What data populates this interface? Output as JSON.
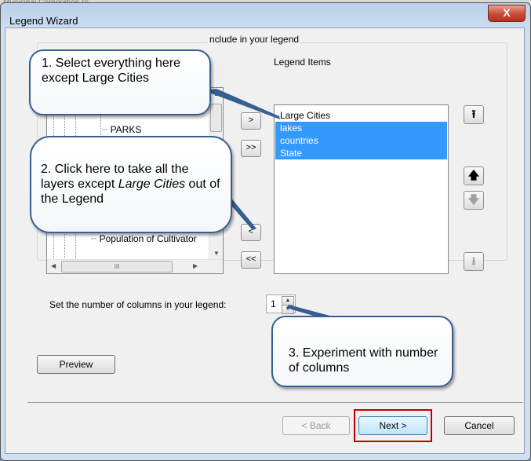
{
  "background": {
    "map_text": "Municipal Corporation ro"
  },
  "window": {
    "title": "Legend Wizard",
    "close_glyph": "X"
  },
  "group": {
    "title": "nclude in your legend"
  },
  "layers_tree": {
    "items": [
      "PARKS",
      "Population of Cultivator"
    ],
    "hscroll_thumb_glyph": "III"
  },
  "transfer_buttons": {
    "add": ">",
    "add_all": ">>",
    "remove": "<",
    "remove_all": "<<"
  },
  "legend_items": {
    "label": "Legend Items",
    "items": [
      {
        "text": "Large Cities",
        "selected": false
      },
      {
        "text": "lakes",
        "selected": true
      },
      {
        "text": "countries",
        "selected": true
      },
      {
        "text": "State",
        "selected": true
      }
    ]
  },
  "order_buttons": {
    "top": "⭱",
    "up": "🡅",
    "down": "🡇",
    "bottom": "⭳"
  },
  "columns": {
    "label": "Set the number of columns in your legend:",
    "value": "1",
    "spin_up": "▲",
    "spin_down": "▼"
  },
  "buttons": {
    "preview": "Preview",
    "back": "< Back",
    "next": "Next >",
    "cancel": "Cancel"
  },
  "callouts": {
    "c1": "1. Select everything here except Large Cities",
    "c2_a": "2. Click here to take all the layers except ",
    "c2_em": "Large Cities",
    "c2_b": " out of the Legend",
    "c3": "3. Experiment with number of columns"
  },
  "colors": {
    "selection": "#3399ff",
    "callout_border": "#365f91",
    "highlight": "#c00000"
  }
}
